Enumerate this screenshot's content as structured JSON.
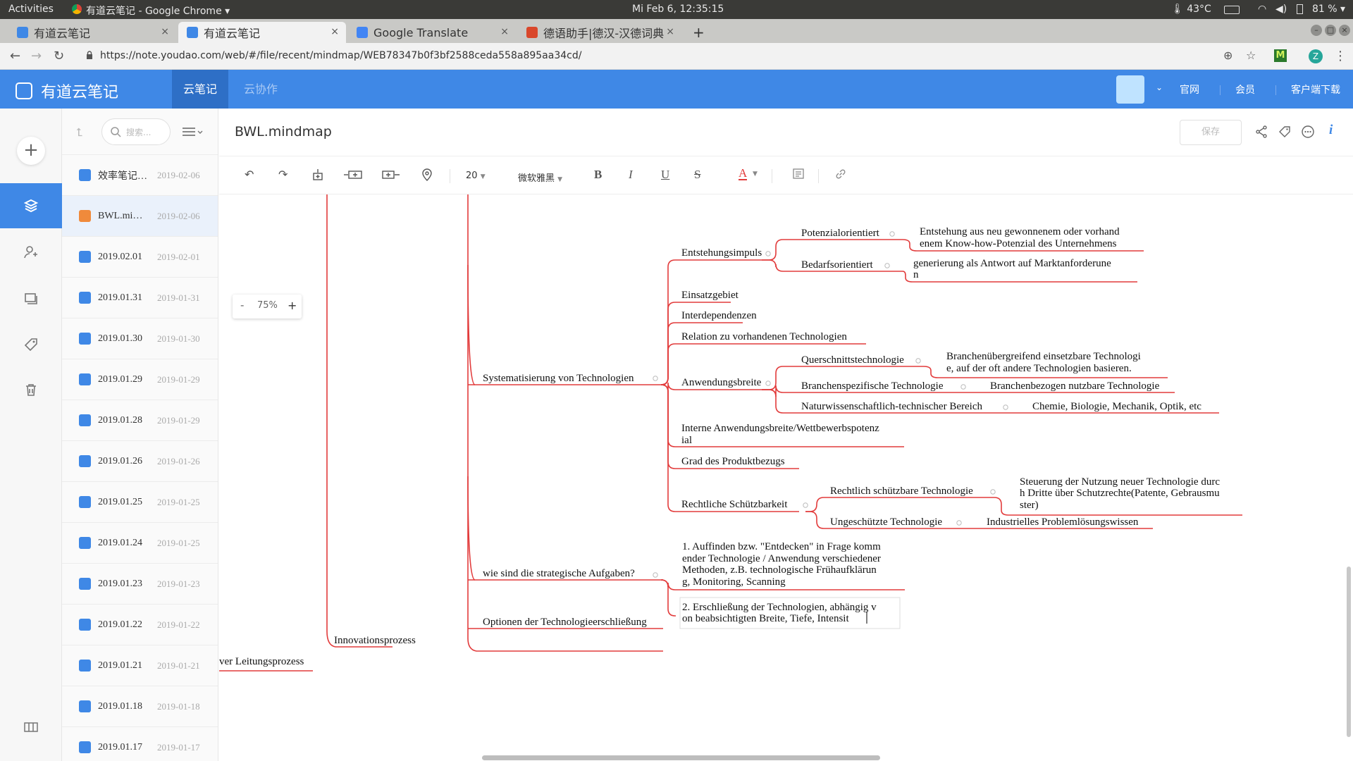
{
  "system_bar": {
    "activities": "Activities",
    "app_name": "有道云笔记 - Google Chrome ▾",
    "clock": "Mi Feb  6, 12:35:15",
    "temperature": "43°C",
    "battery": "81 % ▾"
  },
  "browser": {
    "tabs": [
      {
        "label": "有道云笔记",
        "color": "#3f88e6"
      },
      {
        "label": "有道云笔记",
        "color": "#3f88e6",
        "active": true
      },
      {
        "label": "Google Translate",
        "color": "#4285f4"
      },
      {
        "label": "德语助手|德汉-汉德词典",
        "color": "#d9472b"
      }
    ],
    "new_tab": "+",
    "close_glyph": "×",
    "url": "https://note.youdao.com/web/#/file/recent/mindmap/WEB78347b0f3bf2588ceda558a895aa34cd/",
    "profile_letter": "Z",
    "extension_letter": "M"
  },
  "app_header": {
    "brand": "有道云笔记",
    "nav": [
      "云笔记",
      "云协作"
    ],
    "links": [
      "官网",
      "会员",
      "客户端下载"
    ],
    "accent": "#3f88e6"
  },
  "note_list": {
    "search_placeholder": "搜索...",
    "items": [
      {
        "title": "效率笔记…",
        "date": "2019-02-06"
      },
      {
        "title": "BWL.mi…",
        "date": "2019-02-06",
        "active": true,
        "kind": "mindmap"
      },
      {
        "title": "2019.02.01",
        "date": "2019-02-01"
      },
      {
        "title": "2019.01.31",
        "date": "2019-01-31"
      },
      {
        "title": "2019.01.30",
        "date": "2019-01-30"
      },
      {
        "title": "2019.01.29",
        "date": "2019-01-29"
      },
      {
        "title": "2019.01.28",
        "date": "2019-01-29"
      },
      {
        "title": "2019.01.26",
        "date": "2019-01-26"
      },
      {
        "title": "2019.01.25",
        "date": "2019-01-25"
      },
      {
        "title": "2019.01.24",
        "date": "2019-01-25"
      },
      {
        "title": "2019.01.23",
        "date": "2019-01-23"
      },
      {
        "title": "2019.01.22",
        "date": "2019-01-22"
      },
      {
        "title": "2019.01.21",
        "date": "2019-01-21"
      },
      {
        "title": "2019.01.18",
        "date": "2019-01-18"
      },
      {
        "title": "2019.01.17",
        "date": "2019-01-17"
      }
    ]
  },
  "editor": {
    "title": "BWL.mindmap",
    "save_label": "保存",
    "font_size": "20",
    "font_family": "微软雅黑",
    "zoom_level": "75%",
    "zoom_minus": "-",
    "zoom_plus": "+",
    "tool_bold": "B",
    "tool_italic": "I",
    "tool_underline": "U",
    "tool_strike": "S",
    "tool_color": "A",
    "info_glyph": "i"
  },
  "mindmap": {
    "branch_color": "#e23b3b",
    "nodes": {
      "leitungsprozess": "ver Leitungsprozess",
      "innovationsprozess": "Innovationsprozess",
      "systematisierung": "Systematisierung von Technologien",
      "strategische": "wie sind die strategische Aufgaben?",
      "optionen": "Optionen der Technologieerschließung",
      "entstehungsimpuls": "Entstehungsimpuls",
      "potenzialorientiert": "Potenzialorientiert",
      "potenzial_desc_1": "Entstehung aus neu gewonnenem oder vorhand",
      "potenzial_desc_2": "enem Know-how-Potenzial des Unternehmens",
      "bedarfsorientiert": "Bedarfsorientiert",
      "bedarf_desc_1": "generierung als Antwort auf Marktanforderune",
      "bedarf_desc_2": "n",
      "einsatzgebiet": "Einsatzgebiet",
      "interdependenzen": "Interdependenzen",
      "relation": "Relation zu vorhandenen Technologien",
      "anwendungsbreite": "Anwendungsbreite",
      "querschnitt": "Querschnittstechnologie",
      "querschnitt_desc_1": "Branchenübergreifend einsetzbare Technologi",
      "querschnitt_desc_2": "e, auf der oft andere Technologien basieren.",
      "branchenspezifisch": "Branchenspezifische Technologie",
      "branchen_desc": "Branchenbezogen nutzbare Technologie",
      "naturwiss": "Naturwissenschaftlich-technischer Bereich",
      "naturwiss_desc": "Chemie, Biologie, Mechanik, Optik, etc",
      "interne_1": "Interne Anwendungsbreite/Wettbewerbspotenz",
      "interne_2": "ial",
      "produktbezug": "Grad des Produktbezugs",
      "rechtliche": "Rechtliche Schützbarkeit",
      "schuetzbar": "Rechtlich schützbare Technologie",
      "schuetzbar_desc_1": "Steuerung der Nutzung neuer Technologie durc",
      "schuetzbar_desc_2": "h Dritte über Schutzrechte(Patente, Gebrausmu",
      "schuetzbar_desc_3": "ster)",
      "ungeschuetzt": "Ungeschützte Technologie",
      "ungeschuetzt_desc": "Industrielles Problemlösungswissen",
      "aufgabe1_1": "1. Auffinden bzw. \"Entdecken\" in Frage komm",
      "aufgabe1_2": "ender Technologie / Anwendung verschiedener",
      "aufgabe1_3": "Methoden, z.B. technologische Frühaufklärun",
      "aufgabe1_4": "g, Monitoring, Scanning",
      "aufgabe2_1": "2. Erschließung der Technologien, abhängig v",
      "aufgabe2_2": "on beabsichtigten Breite, Tiefe, Intensit"
    }
  }
}
